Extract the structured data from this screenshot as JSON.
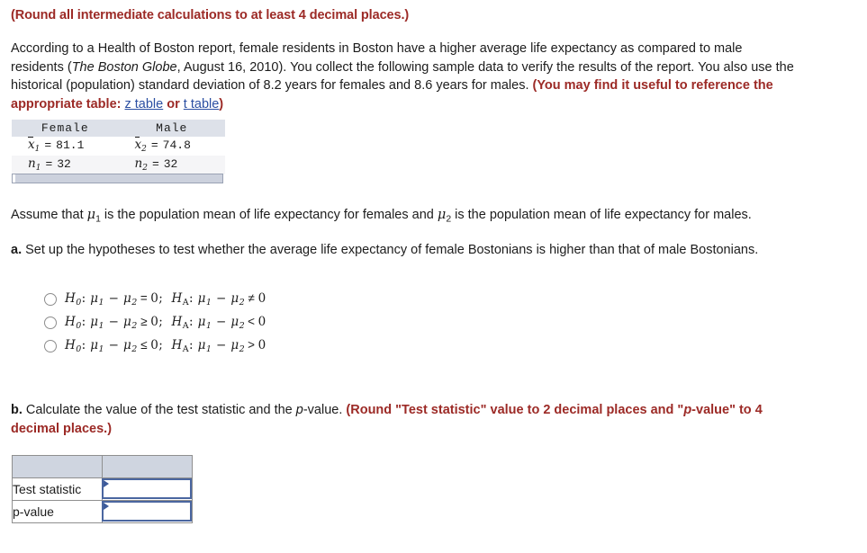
{
  "colors": {
    "accent_red": "#9c2a26",
    "link_blue": "#2b4fa2",
    "table_header": "#dde1e9",
    "answer_header": "#cfd5e0",
    "input_border": "#4a66a0"
  },
  "intro_note": "(Round all intermediate calculations to at least 4 decimal places.)",
  "problem": {
    "line1_a": "According to a Health of Boston report, female residents in Boston have a higher average life expectancy as compared to male",
    "line2_a": "residents (",
    "source_italic": "The Boston Globe",
    "line2_b": ", August 16, 2010). You collect the following sample data to verify the results of the report. You also use the",
    "line3_a": "historical (population) standard deviation of 8.2 years for females and 8.6 years for males. ",
    "line3_red": "(You may find it useful to reference the",
    "line4_red_a": "appropriate table:",
    "link_z": "z table",
    "line4_or": "or",
    "link_t": "t table",
    "line4_end": ")"
  },
  "sample_table": {
    "headers": [
      "Female",
      "Male"
    ],
    "rows": [
      {
        "female_symbol": "x",
        "female_index": "1",
        "female_op": "=",
        "female_value": "81.1",
        "male_symbol": "x",
        "male_index": "2",
        "male_op": "=",
        "male_value": "74.8",
        "overbar": true
      },
      {
        "female_symbol": "n",
        "female_index": "1",
        "female_op": "=",
        "female_value": "32",
        "male_symbol": "n",
        "male_index": "2",
        "male_op": "=",
        "male_value": "32",
        "overbar": false
      }
    ]
  },
  "assume_text": {
    "part1": "Assume that ",
    "mu1": "μ",
    "mu1_sub": "1",
    "part2": " is the population mean of life expectancy for females and ",
    "mu2": "μ",
    "mu2_sub": "2",
    "part3": " is the population mean of life expectancy for males."
  },
  "part_a": {
    "marker": "a.",
    "text": " Set up the hypotheses to test whether the average life expectancy of female Bostonians is higher than that of male Bostonians."
  },
  "hypothesis_options": [
    {
      "null_label": "H",
      "null_sub": "0",
      "alt_label": "H",
      "alt_sub": "A",
      "mu": "μ",
      "minus": "−",
      "null_op": "=",
      "null_value": "0",
      "alt_op": "≠",
      "alt_value": "0",
      "selected": false
    },
    {
      "null_label": "H",
      "null_sub": "0",
      "alt_label": "H",
      "alt_sub": "A",
      "mu": "μ",
      "minus": "−",
      "null_op": "≥",
      "null_value": "0",
      "alt_op": "<",
      "alt_value": "0",
      "selected": false
    },
    {
      "null_label": "H",
      "null_sub": "0",
      "alt_label": "H",
      "alt_sub": "A",
      "mu": "μ",
      "minus": "−",
      "null_op": "≤",
      "null_value": "0",
      "alt_op": ">",
      "alt_value": "0",
      "selected": false
    }
  ],
  "part_b": {
    "marker": "b.",
    "text_a": " Calculate the value of the test statistic and the ",
    "p_italic": "p",
    "text_b": "-value. ",
    "red_a": "(Round \"Test statistic\" value to 2 decimal places and \"",
    "red_p": "p",
    "red_b": "-value\" to 4",
    "red_line2": "decimal places.)"
  },
  "answer_table": {
    "header_cells": [
      "",
      ""
    ],
    "rows": [
      {
        "label": "Test statistic",
        "value": ""
      },
      {
        "label": "p-value",
        "value": ""
      }
    ]
  }
}
